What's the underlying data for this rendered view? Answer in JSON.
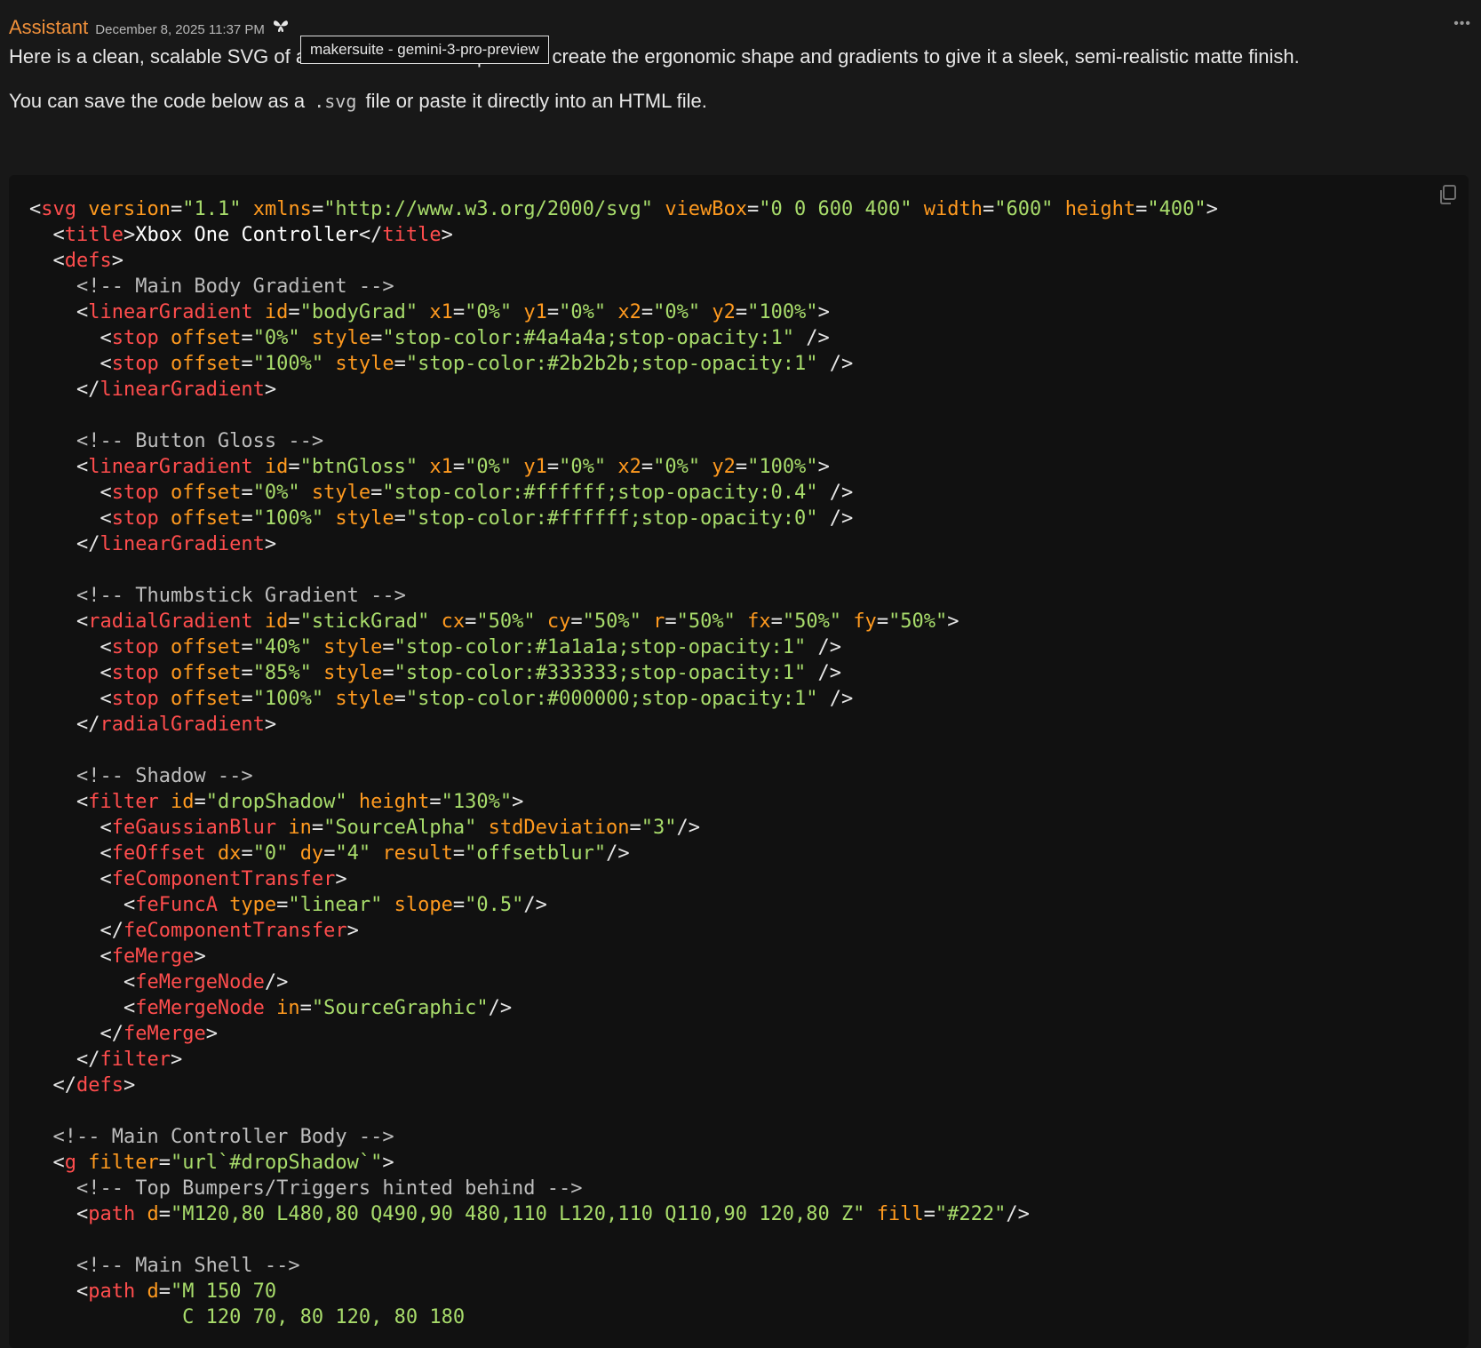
{
  "message": {
    "sender": "Assistant",
    "timestamp": "December 8, 2025 11:37 PM",
    "model_icon": "sparkle-icon",
    "more_label": "•••",
    "tooltip": "makersuite - gemini-3-pro-preview",
    "para1": "Here is a clean, scalable SVG of a",
    "para1_rest": " I have used vector paths to create the ergonomic shape and gradients to give it a sleek, semi-realistic matte finish.",
    "para2_pre": "You can save the code below as a ",
    "para2_code": ".svg",
    "para2_post": " file or paste it directly into an HTML file."
  },
  "code": {
    "copy_icon": "copy-icon",
    "lines": [
      [
        [
          "p",
          "<"
        ],
        [
          "t",
          "svg"
        ],
        [
          "p",
          " "
        ],
        [
          "a",
          "version"
        ],
        [
          "p",
          "="
        ],
        [
          "s",
          "\"1.1\""
        ],
        [
          "p",
          " "
        ],
        [
          "a",
          "xmlns"
        ],
        [
          "p",
          "="
        ],
        [
          "s",
          "\"http://www.w3.org/2000/svg\""
        ],
        [
          "p",
          " "
        ],
        [
          "a",
          "viewBox"
        ],
        [
          "p",
          "="
        ],
        [
          "s",
          "\"0 0 600 400\""
        ],
        [
          "p",
          " "
        ],
        [
          "a",
          "width"
        ],
        [
          "p",
          "="
        ],
        [
          "s",
          "\"600\""
        ],
        [
          "p",
          " "
        ],
        [
          "a",
          "height"
        ],
        [
          "p",
          "="
        ],
        [
          "s",
          "\"400\""
        ],
        [
          "p",
          ">"
        ]
      ],
      [
        [
          "p",
          "  <"
        ],
        [
          "t",
          "title"
        ],
        [
          "p",
          ">"
        ],
        [
          "x",
          "Xbox One Controller"
        ],
        [
          "p",
          "</"
        ],
        [
          "t",
          "title"
        ],
        [
          "p",
          ">"
        ]
      ],
      [
        [
          "p",
          "  <"
        ],
        [
          "t",
          "defs"
        ],
        [
          "p",
          ">"
        ]
      ],
      [
        [
          "c",
          "    <!-- Main Body Gradient -->"
        ]
      ],
      [
        [
          "p",
          "    <"
        ],
        [
          "t",
          "linearGradient"
        ],
        [
          "p",
          " "
        ],
        [
          "a",
          "id"
        ],
        [
          "p",
          "="
        ],
        [
          "s",
          "\"bodyGrad\""
        ],
        [
          "p",
          " "
        ],
        [
          "a",
          "x1"
        ],
        [
          "p",
          "="
        ],
        [
          "s",
          "\"0%\""
        ],
        [
          "p",
          " "
        ],
        [
          "a",
          "y1"
        ],
        [
          "p",
          "="
        ],
        [
          "s",
          "\"0%\""
        ],
        [
          "p",
          " "
        ],
        [
          "a",
          "x2"
        ],
        [
          "p",
          "="
        ],
        [
          "s",
          "\"0%\""
        ],
        [
          "p",
          " "
        ],
        [
          "a",
          "y2"
        ],
        [
          "p",
          "="
        ],
        [
          "s",
          "\"100%\""
        ],
        [
          "p",
          ">"
        ]
      ],
      [
        [
          "p",
          "      <"
        ],
        [
          "t",
          "stop"
        ],
        [
          "p",
          " "
        ],
        [
          "a",
          "offset"
        ],
        [
          "p",
          "="
        ],
        [
          "s",
          "\"0%\""
        ],
        [
          "p",
          " "
        ],
        [
          "a",
          "style"
        ],
        [
          "p",
          "="
        ],
        [
          "s",
          "\"stop-color:#4a4a4a;stop-opacity:1\""
        ],
        [
          "p",
          " />"
        ]
      ],
      [
        [
          "p",
          "      <"
        ],
        [
          "t",
          "stop"
        ],
        [
          "p",
          " "
        ],
        [
          "a",
          "offset"
        ],
        [
          "p",
          "="
        ],
        [
          "s",
          "\"100%\""
        ],
        [
          "p",
          " "
        ],
        [
          "a",
          "style"
        ],
        [
          "p",
          "="
        ],
        [
          "s",
          "\"stop-color:#2b2b2b;stop-opacity:1\""
        ],
        [
          "p",
          " />"
        ]
      ],
      [
        [
          "p",
          "    </"
        ],
        [
          "t",
          "linearGradient"
        ],
        [
          "p",
          ">"
        ]
      ],
      [],
      [
        [
          "c",
          "    <!-- Button Gloss -->"
        ]
      ],
      [
        [
          "p",
          "    <"
        ],
        [
          "t",
          "linearGradient"
        ],
        [
          "p",
          " "
        ],
        [
          "a",
          "id"
        ],
        [
          "p",
          "="
        ],
        [
          "s",
          "\"btnGloss\""
        ],
        [
          "p",
          " "
        ],
        [
          "a",
          "x1"
        ],
        [
          "p",
          "="
        ],
        [
          "s",
          "\"0%\""
        ],
        [
          "p",
          " "
        ],
        [
          "a",
          "y1"
        ],
        [
          "p",
          "="
        ],
        [
          "s",
          "\"0%\""
        ],
        [
          "p",
          " "
        ],
        [
          "a",
          "x2"
        ],
        [
          "p",
          "="
        ],
        [
          "s",
          "\"0%\""
        ],
        [
          "p",
          " "
        ],
        [
          "a",
          "y2"
        ],
        [
          "p",
          "="
        ],
        [
          "s",
          "\"100%\""
        ],
        [
          "p",
          ">"
        ]
      ],
      [
        [
          "p",
          "      <"
        ],
        [
          "t",
          "stop"
        ],
        [
          "p",
          " "
        ],
        [
          "a",
          "offset"
        ],
        [
          "p",
          "="
        ],
        [
          "s",
          "\"0%\""
        ],
        [
          "p",
          " "
        ],
        [
          "a",
          "style"
        ],
        [
          "p",
          "="
        ],
        [
          "s",
          "\"stop-color:#ffffff;stop-opacity:0.4\""
        ],
        [
          "p",
          " />"
        ]
      ],
      [
        [
          "p",
          "      <"
        ],
        [
          "t",
          "stop"
        ],
        [
          "p",
          " "
        ],
        [
          "a",
          "offset"
        ],
        [
          "p",
          "="
        ],
        [
          "s",
          "\"100%\""
        ],
        [
          "p",
          " "
        ],
        [
          "a",
          "style"
        ],
        [
          "p",
          "="
        ],
        [
          "s",
          "\"stop-color:#ffffff;stop-opacity:0\""
        ],
        [
          "p",
          " />"
        ]
      ],
      [
        [
          "p",
          "    </"
        ],
        [
          "t",
          "linearGradient"
        ],
        [
          "p",
          ">"
        ]
      ],
      [],
      [
        [
          "c",
          "    <!-- Thumbstick Gradient -->"
        ]
      ],
      [
        [
          "p",
          "    <"
        ],
        [
          "t",
          "radialGradient"
        ],
        [
          "p",
          " "
        ],
        [
          "a",
          "id"
        ],
        [
          "p",
          "="
        ],
        [
          "s",
          "\"stickGrad\""
        ],
        [
          "p",
          " "
        ],
        [
          "a",
          "cx"
        ],
        [
          "p",
          "="
        ],
        [
          "s",
          "\"50%\""
        ],
        [
          "p",
          " "
        ],
        [
          "a",
          "cy"
        ],
        [
          "p",
          "="
        ],
        [
          "s",
          "\"50%\""
        ],
        [
          "p",
          " "
        ],
        [
          "a",
          "r"
        ],
        [
          "p",
          "="
        ],
        [
          "s",
          "\"50%\""
        ],
        [
          "p",
          " "
        ],
        [
          "a",
          "fx"
        ],
        [
          "p",
          "="
        ],
        [
          "s",
          "\"50%\""
        ],
        [
          "p",
          " "
        ],
        [
          "a",
          "fy"
        ],
        [
          "p",
          "="
        ],
        [
          "s",
          "\"50%\""
        ],
        [
          "p",
          ">"
        ]
      ],
      [
        [
          "p",
          "      <"
        ],
        [
          "t",
          "stop"
        ],
        [
          "p",
          " "
        ],
        [
          "a",
          "offset"
        ],
        [
          "p",
          "="
        ],
        [
          "s",
          "\"40%\""
        ],
        [
          "p",
          " "
        ],
        [
          "a",
          "style"
        ],
        [
          "p",
          "="
        ],
        [
          "s",
          "\"stop-color:#1a1a1a;stop-opacity:1\""
        ],
        [
          "p",
          " />"
        ]
      ],
      [
        [
          "p",
          "      <"
        ],
        [
          "t",
          "stop"
        ],
        [
          "p",
          " "
        ],
        [
          "a",
          "offset"
        ],
        [
          "p",
          "="
        ],
        [
          "s",
          "\"85%\""
        ],
        [
          "p",
          " "
        ],
        [
          "a",
          "style"
        ],
        [
          "p",
          "="
        ],
        [
          "s",
          "\"stop-color:#333333;stop-opacity:1\""
        ],
        [
          "p",
          " />"
        ]
      ],
      [
        [
          "p",
          "      <"
        ],
        [
          "t",
          "stop"
        ],
        [
          "p",
          " "
        ],
        [
          "a",
          "offset"
        ],
        [
          "p",
          "="
        ],
        [
          "s",
          "\"100%\""
        ],
        [
          "p",
          " "
        ],
        [
          "a",
          "style"
        ],
        [
          "p",
          "="
        ],
        [
          "s",
          "\"stop-color:#000000;stop-opacity:1\""
        ],
        [
          "p",
          " />"
        ]
      ],
      [
        [
          "p",
          "    </"
        ],
        [
          "t",
          "radialGradient"
        ],
        [
          "p",
          ">"
        ]
      ],
      [],
      [
        [
          "c",
          "    <!-- Shadow -->"
        ]
      ],
      [
        [
          "p",
          "    <"
        ],
        [
          "t",
          "filter"
        ],
        [
          "p",
          " "
        ],
        [
          "a",
          "id"
        ],
        [
          "p",
          "="
        ],
        [
          "s",
          "\"dropShadow\""
        ],
        [
          "p",
          " "
        ],
        [
          "a",
          "height"
        ],
        [
          "p",
          "="
        ],
        [
          "s",
          "\"130%\""
        ],
        [
          "p",
          ">"
        ]
      ],
      [
        [
          "p",
          "      <"
        ],
        [
          "t",
          "feGaussianBlur"
        ],
        [
          "p",
          " "
        ],
        [
          "a",
          "in"
        ],
        [
          "p",
          "="
        ],
        [
          "s",
          "\"SourceAlpha\""
        ],
        [
          "p",
          " "
        ],
        [
          "a",
          "stdDeviation"
        ],
        [
          "p",
          "="
        ],
        [
          "s",
          "\"3\""
        ],
        [
          "p",
          "/>"
        ]
      ],
      [
        [
          "p",
          "      <"
        ],
        [
          "t",
          "feOffset"
        ],
        [
          "p",
          " "
        ],
        [
          "a",
          "dx"
        ],
        [
          "p",
          "="
        ],
        [
          "s",
          "\"0\""
        ],
        [
          "p",
          " "
        ],
        [
          "a",
          "dy"
        ],
        [
          "p",
          "="
        ],
        [
          "s",
          "\"4\""
        ],
        [
          "p",
          " "
        ],
        [
          "a",
          "result"
        ],
        [
          "p",
          "="
        ],
        [
          "s",
          "\"offsetblur\""
        ],
        [
          "p",
          "/>"
        ]
      ],
      [
        [
          "p",
          "      <"
        ],
        [
          "t",
          "feComponentTransfer"
        ],
        [
          "p",
          ">"
        ]
      ],
      [
        [
          "p",
          "        <"
        ],
        [
          "t",
          "feFuncA"
        ],
        [
          "p",
          " "
        ],
        [
          "a",
          "type"
        ],
        [
          "p",
          "="
        ],
        [
          "s",
          "\"linear\""
        ],
        [
          "p",
          " "
        ],
        [
          "a",
          "slope"
        ],
        [
          "p",
          "="
        ],
        [
          "s",
          "\"0.5\""
        ],
        [
          "p",
          "/>"
        ]
      ],
      [
        [
          "p",
          "      </"
        ],
        [
          "t",
          "feComponentTransfer"
        ],
        [
          "p",
          ">"
        ]
      ],
      [
        [
          "p",
          "      <"
        ],
        [
          "t",
          "feMerge"
        ],
        [
          "p",
          ">"
        ]
      ],
      [
        [
          "p",
          "        <"
        ],
        [
          "t",
          "feMergeNode"
        ],
        [
          "p",
          "/>"
        ]
      ],
      [
        [
          "p",
          "        <"
        ],
        [
          "t",
          "feMergeNode"
        ],
        [
          "p",
          " "
        ],
        [
          "a",
          "in"
        ],
        [
          "p",
          "="
        ],
        [
          "s",
          "\"SourceGraphic\""
        ],
        [
          "p",
          "/>"
        ]
      ],
      [
        [
          "p",
          "      </"
        ],
        [
          "t",
          "feMerge"
        ],
        [
          "p",
          ">"
        ]
      ],
      [
        [
          "p",
          "    </"
        ],
        [
          "t",
          "filter"
        ],
        [
          "p",
          ">"
        ]
      ],
      [
        [
          "p",
          "  </"
        ],
        [
          "t",
          "defs"
        ],
        [
          "p",
          ">"
        ]
      ],
      [],
      [
        [
          "c",
          "  <!-- Main Controller Body -->"
        ]
      ],
      [
        [
          "p",
          "  <"
        ],
        [
          "t",
          "g"
        ],
        [
          "p",
          " "
        ],
        [
          "a",
          "filter"
        ],
        [
          "p",
          "="
        ],
        [
          "s",
          "\"url`#dropShadow`\""
        ],
        [
          "p",
          ">"
        ]
      ],
      [
        [
          "c",
          "    <!-- Top Bumpers/Triggers hinted behind -->"
        ]
      ],
      [
        [
          "p",
          "    <"
        ],
        [
          "t",
          "path"
        ],
        [
          "p",
          " "
        ],
        [
          "a",
          "d"
        ],
        [
          "p",
          "="
        ],
        [
          "s",
          "\"M120,80 L480,80 Q490,90 480,110 L120,110 Q110,90 120,80 Z\""
        ],
        [
          "p",
          " "
        ],
        [
          "a",
          "fill"
        ],
        [
          "p",
          "="
        ],
        [
          "s",
          "\"#222\""
        ],
        [
          "p",
          "/>"
        ]
      ],
      [],
      [
        [
          "c",
          "    <!-- Main Shell -->"
        ]
      ],
      [
        [
          "p",
          "    <"
        ],
        [
          "t",
          "path"
        ],
        [
          "p",
          " "
        ],
        [
          "a",
          "d"
        ],
        [
          "p",
          "="
        ],
        [
          "s",
          "\"M 150 70"
        ]
      ],
      [
        [
          "s",
          "             C 120 70, 80 120, 80 180"
        ]
      ]
    ]
  }
}
